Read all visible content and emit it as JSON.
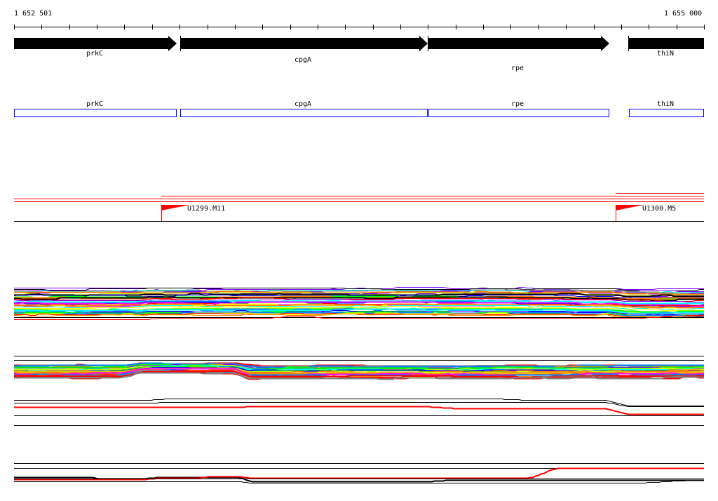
{
  "ruler": {
    "start_label": "1 652 501",
    "end_label": "1 655 000"
  },
  "genes": [
    {
      "name": "prkC",
      "strand": "+"
    },
    {
      "name": "cpgA",
      "strand": "+"
    },
    {
      "name": "rpe",
      "strand": "+"
    },
    {
      "name": "thiN",
      "strand": "+"
    }
  ],
  "gene_boxes": [
    {
      "name": "prkC"
    },
    {
      "name": "cpgA"
    },
    {
      "name": "rpe"
    },
    {
      "name": "thiN"
    }
  ],
  "markers": [
    {
      "label": "U1299.M11"
    },
    {
      "label": "U1300.M5"
    }
  ],
  "colors": {
    "gene": "#000000",
    "gene_box": "#0000ff",
    "marker": "#ff0000",
    "signal_palette": [
      "#ff0000",
      "#00ff00",
      "#0000ff",
      "#ff00ff",
      "#00ffff",
      "#ff8000",
      "#808080",
      "#c0ff00",
      "#0080ff",
      "#000000",
      "#ffff00",
      "#8000ff"
    ]
  }
}
